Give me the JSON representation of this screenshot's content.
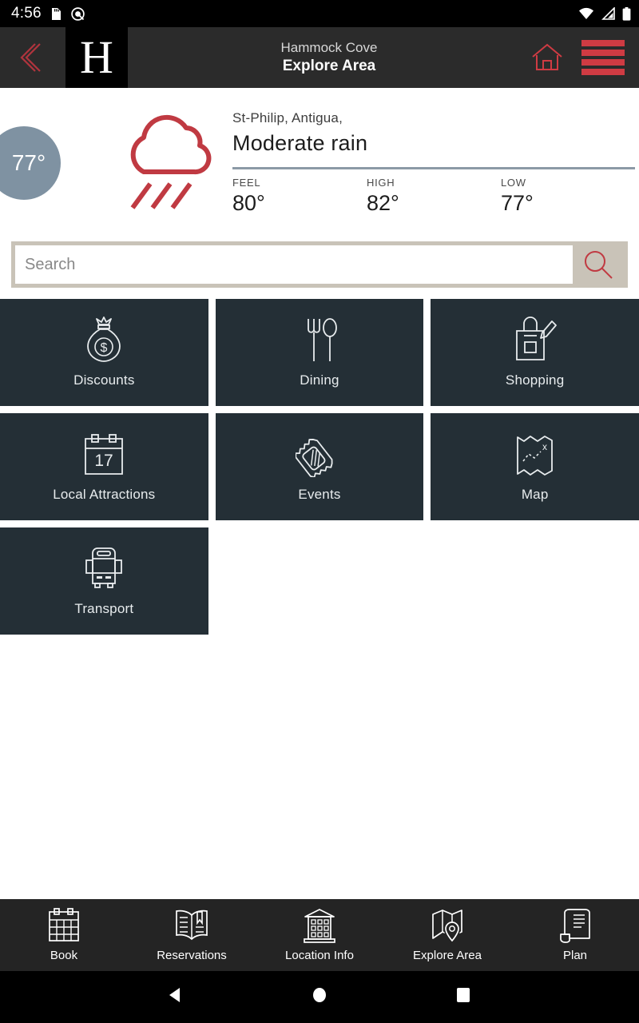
{
  "status_bar": {
    "time": "4:56",
    "icons_left": [
      "sd-card-icon",
      "do-not-disturb-icon"
    ],
    "icons_right": [
      "wifi-icon",
      "cellular-signal-icon",
      "battery-icon"
    ]
  },
  "header": {
    "back_icon": "chevron-left-icon",
    "logo_letter": "H",
    "subtitle": "Hammock Cove",
    "title": "Explore Area",
    "home_icon": "home-icon",
    "menu_icon": "hamburger-menu-icon",
    "accent_color": "#cf3b43",
    "background_color": "#2b2b2b"
  },
  "weather": {
    "current_temp": "77°",
    "condition_icon": "rain-cloud-icon",
    "location": "St-Philip, Antigua,",
    "condition": "Moderate rain",
    "circle_color": "#7f92a2",
    "icon_color": "#c03a42",
    "stats": [
      {
        "label": "FEEL",
        "value": "80°"
      },
      {
        "label": "HIGH",
        "value": "82°"
      },
      {
        "label": "LOW",
        "value": "77°"
      }
    ]
  },
  "search": {
    "placeholder": "Search",
    "value": "",
    "button_icon": "search-icon",
    "frame_color": "#c9c3b8"
  },
  "tiles": [
    {
      "label": "Discounts",
      "icon": "money-bag-icon"
    },
    {
      "label": "Dining",
      "icon": "fork-spoon-icon"
    },
    {
      "label": "Shopping",
      "icon": "shopping-bag-icon"
    },
    {
      "label": "Local Attractions",
      "icon": "calendar-17-icon"
    },
    {
      "label": "Events",
      "icon": "ticket-icon"
    },
    {
      "label": "Map",
      "icon": "treasure-map-icon"
    },
    {
      "label": "Transport",
      "icon": "bus-icon"
    }
  ],
  "tile_color": "#242f36",
  "bottom_nav": [
    {
      "label": "Book",
      "icon": "calendar-icon"
    },
    {
      "label": "Reservations",
      "icon": "open-book-icon"
    },
    {
      "label": "Location Info",
      "icon": "building-icon"
    },
    {
      "label": "Explore Area",
      "icon": "map-pin-icon"
    },
    {
      "label": "Plan",
      "icon": "scroll-document-icon"
    }
  ],
  "system_nav": {
    "back": "triangle-back-icon",
    "home": "circle-home-icon",
    "recents": "square-recents-icon"
  }
}
